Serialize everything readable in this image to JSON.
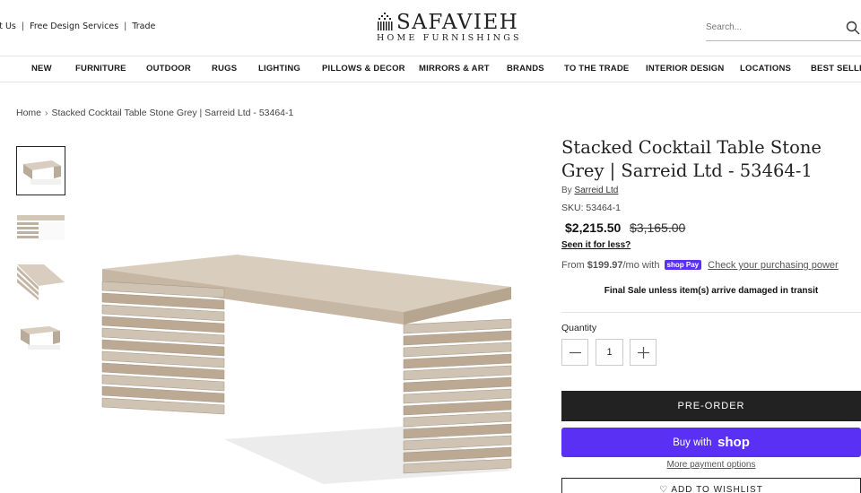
{
  "header": {
    "util_links": [
      "ct Us",
      "Free Design Services",
      "Trade"
    ],
    "logo_brand": "SAFAVIEH",
    "logo_sub": "HOME FURNISHINGS",
    "search_placeholder": "Search...",
    "icons": {
      "search": "search-icon",
      "logo_mark": "logo-mark-icon"
    }
  },
  "nav": {
    "items": [
      "NEW",
      "FURNITURE",
      "OUTDOOR",
      "RUGS",
      "LIGHTING",
      "PILLOWS & DECOR",
      "MIRRORS & ART",
      "BRANDS",
      "TO THE TRADE",
      "INTERIOR DESIGN",
      "LOCATIONS",
      "BEST SELLERS"
    ]
  },
  "breadcrumb": {
    "home": "Home",
    "current": "Stacked Cocktail Table Stone Grey | Sarreid Ltd - 53464-1"
  },
  "product": {
    "title": "Stacked Cocktail Table Stone Grey | Sarreid Ltd - 53464-1",
    "by_prefix": "By",
    "brand": "Sarreid Ltd",
    "sku": "SKU: 53464-1",
    "price": "$2,215.50",
    "compare_price": "$3,165.00",
    "seen_less": "Seen it for less?",
    "installment_prefix": "From",
    "installment_amount": "$199.97",
    "installment_suffix": "/mo with",
    "shoppay_badge": "shop Pay",
    "check_power": "Check your purchasing power",
    "final_sale": "Final Sale unless item(s) arrive damaged in transit",
    "quantity_label": "Quantity",
    "quantity_value": "1",
    "preorder": "PRE-ORDER",
    "buy_with": "Buy with",
    "shop_word": "shop",
    "more_payment": "More payment options",
    "wishlist": "ADD TO WISHLIST"
  },
  "colors": {
    "accent_shop": "#5a31f4",
    "button_dark": "#222222",
    "wood": "#cfc3b4"
  }
}
